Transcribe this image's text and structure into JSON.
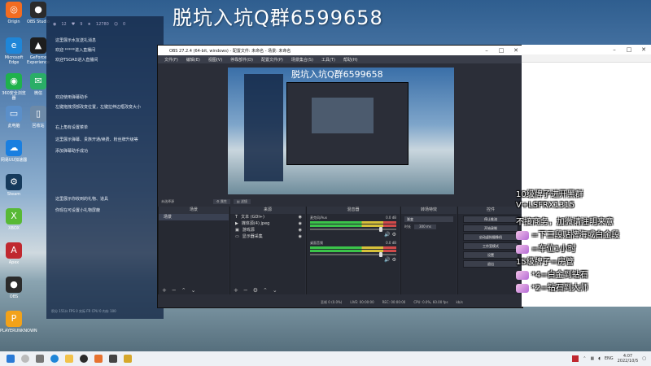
{
  "overlay_title": "脱坑入坑Q群6599658",
  "desktop_icons": [
    {
      "name": "Origin",
      "color": "#f36c21",
      "glyph": "◎"
    },
    {
      "name": "OBS Studio",
      "color": "#2b2b2b",
      "glyph": "●"
    },
    {
      "name": "Microsoft Edge",
      "color": "#1f86d8",
      "glyph": "e"
    },
    {
      "name": "GeForce Experience",
      "color": "#1d1d1d",
      "glyph": "▲"
    },
    {
      "name": "360安全浏览器",
      "color": "#1fb24c",
      "glyph": "◉"
    },
    {
      "name": "微信",
      "color": "#2aae67",
      "glyph": "✉"
    },
    {
      "name": "此电脑",
      "color": "#5b8fc9",
      "glyph": "▭"
    },
    {
      "name": "回收站",
      "color": "#6d8aa8",
      "glyph": "▯"
    },
    {
      "name": "网易UU加速器",
      "color": "#1a7fe0",
      "glyph": "☁"
    },
    {
      "name": "Steam",
      "color": "#163a5c",
      "glyph": "⚙"
    },
    {
      "name": "XBOX",
      "color": "#58b935",
      "glyph": "X"
    },
    {
      "name": "Apex",
      "color": "#c0282f",
      "glyph": "A"
    },
    {
      "name": "OBS",
      "color": "#2b2b2b",
      "glyph": "●"
    },
    {
      "name": "PLAYERUNKNOWN",
      "color": "#f2a21a",
      "glyph": "P"
    }
  ],
  "chat": {
    "top_counts": [
      "12",
      "9",
      "12780",
      "0"
    ],
    "messages": [
      "这里展示水友送礼消息",
      "欢迎 *****进入直播间",
      "欢迎TSOAD进入直播间",
      "欢迎使用弹幕助手",
      "左键拖拽顶部改变位置，左键拉伸边框改变大小",
      "右上角有设置菜单",
      "这里展示弹幕、贵族开通/续费、粉丝牌升级等",
      "添加弹幕助手成功",
      "这里展示你收到的礼物、道具",
      "你现在可设置小礼物屏蔽"
    ],
    "footer": "积分 151/s FPS 0 实际 FR  CPU 0  内存 100"
  },
  "obs": {
    "title": "OBS 27.2.4 (64-bit, windows) - 配置文件: 未命名 - 场景: 未命名",
    "menus": [
      "文件(F)",
      "编辑(E)",
      "视图(V)",
      "停靠部件(D)",
      "配置文件(P)",
      "场景集合(S)",
      "工具(T)",
      "帮助(H)"
    ],
    "preview_overlay": "脱坑入坑Q群6599658",
    "no_source": "未选择源",
    "props_btn": "属性",
    "filters_btn": "滤镜",
    "docks": {
      "scenes": {
        "header": "场景",
        "items": [
          "场景"
        ]
      },
      "sources": {
        "header": "来源",
        "items": [
          "文本 (GDI+)",
          "媒体源(4) jpeg",
          "游戏源",
          "显示器采集"
        ]
      },
      "mixer": {
        "header": "混音器",
        "rows": [
          {
            "name": "麦克风/Aux",
            "db": "0.0 dB"
          },
          {
            "name": "桌面音频",
            "db": "0.0 dB"
          }
        ]
      },
      "transitions": {
        "header": "转场特效",
        "mode": "渐变",
        "duration_label": "时长",
        "duration": "300 ms"
      },
      "controls": {
        "header": "控件",
        "buttons": [
          "停止推流",
          "开始录制",
          "启动虚拟摄像机",
          "工作室模式",
          "设置",
          "退出"
        ]
      }
    },
    "status": [
      "丢帧 0 (0.0%)",
      "LIVE: 00:00:00",
      "REC: 00:00:00",
      "CPU: 0.0%, 60.00 fps",
      "kb/s"
    ]
  },
  "right_overlay": [
    "10级牌子进开黑群",
    "V+LSFRX1315",
    "不接商务，加微请注明来意",
    "=下三段贴牌海或白金段",
    "=车位1小时",
    "15级牌子=房管",
    "*4=白金到钻石",
    "*2=钻石到大师"
  ],
  "taskbar": {
    "icons": [
      "start",
      "search",
      "taskview",
      "edge",
      "explorer",
      "store",
      "obs",
      "chat",
      "steam",
      "apex"
    ],
    "tray_lang": "ENG",
    "time": "4:07",
    "date": "2022/10/5"
  }
}
